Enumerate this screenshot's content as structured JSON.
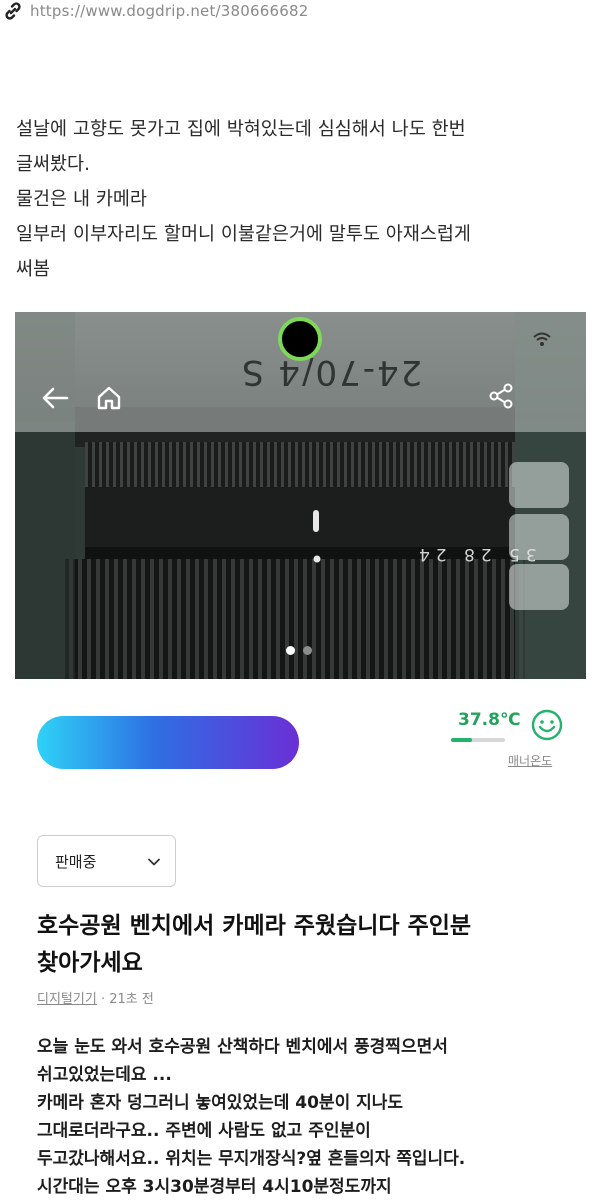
{
  "browser": {
    "url": "https://www.dogdrip.net/380666682",
    "link_icon": "link-icon"
  },
  "intro": {
    "lines": [
      "설날에 고향도 못가고 집에 박혀있는데 심심해서 나도 한번",
      "글써봤다.",
      "물건은 내 카메라",
      "일부러 이부자리도 할머니 이불같은거에 말투도 아재스럽게",
      "써봄"
    ]
  },
  "photo": {
    "lens_text": "24-70/4 S",
    "scale_text": "35 28 24",
    "icons": [
      "back-arrow-icon",
      "home-icon",
      "share-icon",
      "wifi-icon"
    ],
    "page_count": 2,
    "active_page": 1
  },
  "profile": {
    "gradient_colors": [
      "#2fd2f7",
      "#2e6fe3",
      "#6a2fd6"
    ]
  },
  "manner": {
    "temperature": "37.8℃",
    "temperature_value": 37.8,
    "label": "매너온도",
    "color": "#20a35a"
  },
  "status": {
    "selected": "판매중"
  },
  "post": {
    "title_lines": [
      "호수공원 벤치에서 카메라 주웠습니다 주인분",
      "찾아가세요"
    ],
    "category": "디지털기기",
    "time": "21초 전",
    "separator": " · ",
    "body_lines": [
      "오늘 눈도 와서 호수공원 산책하다 벤치에서 풍경찍으면서",
      "쉬고있었는데요 ...",
      "카메라 혼자 덩그러니 놓여있었는데 40분이 지나도",
      "그대로더라구요.. 주변에 사람도 없고 주인분이",
      "두고갔나해서요.. 위치는 무지개장식?옆 흔들의자 쪽입니다.",
      "시간대는 오후 3시30분경부터 4시10분정도까지"
    ]
  }
}
